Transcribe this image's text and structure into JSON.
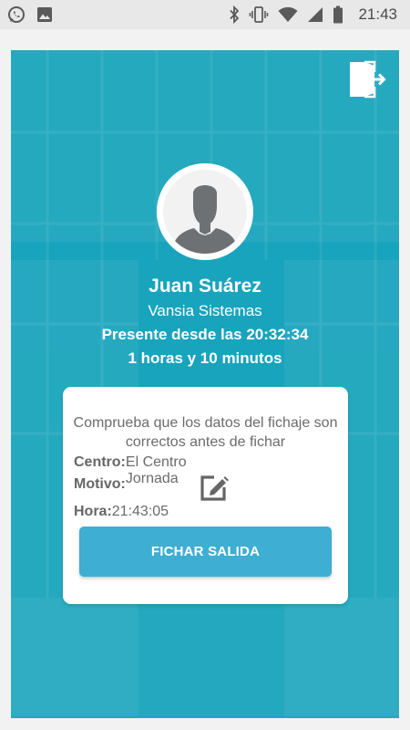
{
  "status_bar": {
    "time": "21:43",
    "left_icons": [
      "whatsapp-icon",
      "image-icon"
    ],
    "right_icons": [
      "bluetooth-icon",
      "vibrate-icon",
      "wifi-icon",
      "signal-icon",
      "battery-icon"
    ]
  },
  "colors": {
    "panel": "#18a4bc",
    "button": "#3eaed3",
    "card": "#ffffff",
    "text_grey": "#6b6b6b"
  },
  "header": {
    "logout_icon": "logout-icon"
  },
  "user": {
    "avatar_icon": "person-avatar-icon",
    "name": "Juan Suárez",
    "company": "Vansia Sistemas",
    "presence": "Presente desde las 20:32:34",
    "duration": "1 horas y 10 minutos"
  },
  "card": {
    "message": "Comprueba que los datos del fichaje son correctos antes de fichar",
    "fields": {
      "centro_label": "Centro:",
      "centro_value": "El Centro",
      "motivo_label": "Motivo:",
      "motivo_value": "Jornada",
      "hora_label": "Hora:",
      "hora_value": "21:43:05"
    },
    "edit_icon": "edit-icon",
    "button_label": "FICHAR SALIDA"
  }
}
